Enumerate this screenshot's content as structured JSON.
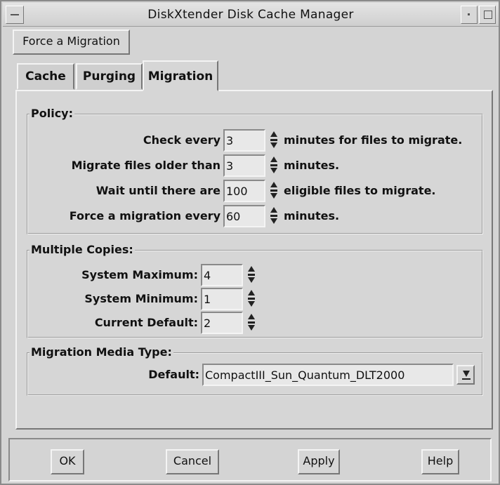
{
  "window": {
    "title": "DiskXtender Disk Cache Manager"
  },
  "toolbar": {
    "force_migration_label": "Force a Migration"
  },
  "tabs": [
    {
      "label": "Cache"
    },
    {
      "label": "Purging"
    },
    {
      "label": "Migration"
    }
  ],
  "active_tab": "Migration",
  "policy": {
    "legend": "Policy:",
    "rows": [
      {
        "label": "Check every",
        "value": "3",
        "suffix": "minutes for files to migrate."
      },
      {
        "label": "Migrate files older than",
        "value": "3",
        "suffix": "minutes."
      },
      {
        "label": "Wait until there are",
        "value": "100",
        "suffix": "eligible files to migrate."
      },
      {
        "label": "Force a migration every",
        "value": "60",
        "suffix": "minutes."
      }
    ]
  },
  "copies": {
    "legend": "Multiple Copies:",
    "rows": [
      {
        "label": "System Maximum:",
        "value": "4"
      },
      {
        "label": "System Minimum:",
        "value": "1"
      },
      {
        "label": "Current Default:",
        "value": "2"
      }
    ]
  },
  "media": {
    "legend": "Migration Media Type:",
    "default_label": "Default:",
    "default_value": "CompactIII_Sun_Quantum_DLT2000"
  },
  "buttons": {
    "ok": "OK",
    "cancel": "Cancel",
    "apply": "Apply",
    "help": "Help"
  }
}
